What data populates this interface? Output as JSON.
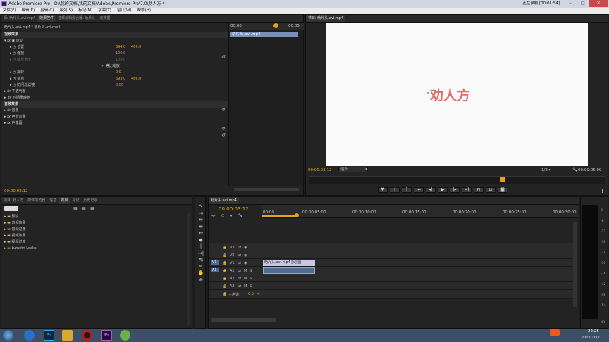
{
  "title_bar": {
    "title": "Adobe Premiere Pro - D:\\我的文档\\我的文档\\Adobe\\Premiere Pro\\7.0\\劝人方 *",
    "recording": "正在录制 [00:01:54]"
  },
  "menu": [
    "文件(F)",
    "编辑(E)",
    "剪辑(C)",
    "序列(S)",
    "标记(M)",
    "字幕(T)",
    "窗口(W)",
    "帮助(H)"
  ],
  "effect_controls": {
    "tabs": [
      "源: 劝片头.avi.mp4",
      "效果控件",
      "音频剪辑混合器: 劝片头",
      "元数据"
    ],
    "clip_path": "劝片头.avi.mp4 * 劝片头.avi.mp4",
    "timecode_start": "00:00",
    "timecode_end": "00:05",
    "clip_label": "劝片头.avi.mp4",
    "video_effects": "视频效果",
    "motion": "运动",
    "position": "位置",
    "position_x": "694.0",
    "position_y": "466.0",
    "scale": "缩放",
    "scale_val": "100.0",
    "scale_width": "缩放宽度",
    "scale_width_val": "100.0",
    "uniform_scale": "等比缩放",
    "rotation": "旋转",
    "rotation_val": "0.0",
    "anchor": "锚点",
    "anchor_x": "693.0",
    "anchor_y": "466.0",
    "anti_flicker": "防闪烁滤镜",
    "anti_flicker_val": "0.00",
    "opacity": "不透明度",
    "time_remap": "时间重映射",
    "audio_effects": "音频效果",
    "volume": "音量",
    "channel_volume": "声道音量",
    "panner": "声像器",
    "current_time": "00:00:03:12"
  },
  "program_monitor": {
    "tab": "节目: 劝片头.avi.mp4",
    "video_text": "劝人方",
    "timecode": "00:00:03:12",
    "fit": "适合",
    "resolution": "1/2",
    "duration": "00:00:05:09"
  },
  "project_panel": {
    "tabs": [
      "项目: 劝人方",
      "媒体浏览器",
      "信息",
      "效果",
      "标记",
      "历史记录"
    ],
    "items": [
      "预设",
      "音频效果",
      "音频过渡",
      "视频效果",
      "视频过渡",
      "Lumetri Looks"
    ]
  },
  "timeline": {
    "tab": "劝片头.avi.mp4",
    "timecode": "00:00:03:12",
    "ruler": [
      "00:00",
      "00:00:05:00",
      "00:00:10:00",
      "00:00:15:00",
      "00:00:20:00",
      "00:00:25:00",
      "00:00:30:00"
    ],
    "tracks": [
      {
        "name": "V3",
        "src": ""
      },
      {
        "name": "V2",
        "src": ""
      },
      {
        "name": "V1",
        "src": "V1"
      },
      {
        "name": "A1",
        "src": "A1"
      },
      {
        "name": "A2",
        "src": ""
      },
      {
        "name": "A3",
        "src": ""
      }
    ],
    "master": "主声道",
    "master_val": "0.0",
    "video_clip": "劝片头.avi.mp4 [V] 圆",
    "ms_m": "M",
    "ms_s": "S"
  },
  "audio_meter": {
    "labels": [
      "0",
      "-6",
      "-12",
      "-18",
      "-24",
      "-30",
      "-36",
      "-42",
      "-48",
      "-54"
    ],
    "db": "dB"
  },
  "taskbar": {
    "time": "22:25",
    "date": "2017/10/27"
  },
  "colors": {
    "accent": "#e2a21e",
    "playhead": "#d43030",
    "title_text": "#e06d6d"
  }
}
